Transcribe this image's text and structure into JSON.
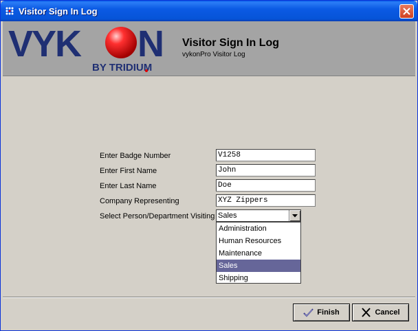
{
  "window": {
    "title": "Visitor Sign In Log"
  },
  "banner": {
    "logo_text": "VYKON",
    "logo_subtext": "BY TRIDIUM",
    "title": "Visitor Sign In Log",
    "subtitle": "vykonPro Visitor Log"
  },
  "form": {
    "badge_label": "Enter Badge Number",
    "badge_value": "V1258",
    "first_label": "Enter First Name",
    "first_value": "John",
    "last_label": "Enter Last Name",
    "last_value": "Doe",
    "company_label": "Company Representing",
    "company_value": "XYZ Zippers",
    "visiting_label": "Select Person/Department Visiting",
    "visiting_value": "Sales",
    "options": [
      "Administration",
      "Human Resources",
      "Maintenance",
      "Sales",
      "Shipping"
    ]
  },
  "buttons": {
    "finish": "Finish",
    "cancel": "Cancel"
  },
  "colors": {
    "titlebar": "#0a5de8",
    "selection": "#666699",
    "banner": "#a4a4a4"
  }
}
